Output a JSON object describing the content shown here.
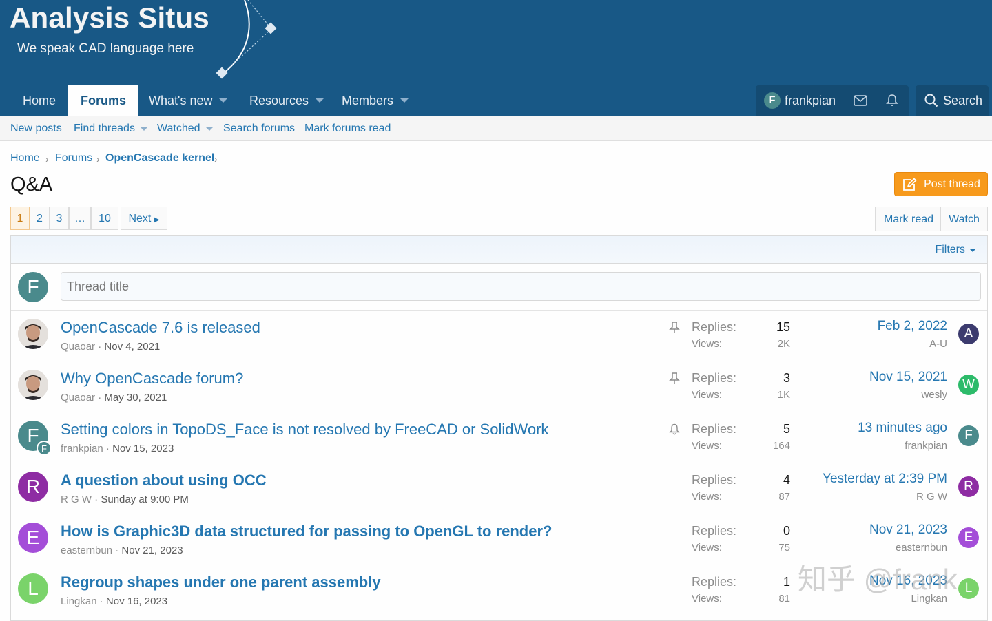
{
  "header": {
    "logo_title": "Analysis Situs",
    "logo_subtitle": "We speak CAD language here"
  },
  "nav": {
    "home": "Home",
    "forums": "Forums",
    "whats_new": "What's new",
    "resources": "Resources",
    "members": "Members",
    "username": "frankpian",
    "user_initial": "F",
    "search": "Search"
  },
  "subnav": {
    "new_posts": "New posts",
    "find_threads": "Find threads",
    "watched": "Watched",
    "search_forums": "Search forums",
    "mark_forums_read": "Mark forums read"
  },
  "breadcrumb": {
    "home": "Home",
    "forums": "Forums",
    "current": "OpenCascade kernel"
  },
  "page": {
    "title": "Q&A",
    "post_thread": "Post thread",
    "mark_read": "Mark read",
    "watch": "Watch",
    "filters": "Filters"
  },
  "pagination": {
    "pages": [
      "1",
      "2",
      "3",
      "…",
      "10"
    ],
    "current": "1",
    "next": "Next"
  },
  "new_thread": {
    "initial": "F",
    "placeholder": "Thread title"
  },
  "labels": {
    "replies": "Replies:",
    "views": "Views:"
  },
  "threads": [
    {
      "title": "OpenCascade 7.6 is released",
      "author": "Quaoar",
      "date": "Nov 4, 2021",
      "status_icon": "pin-icon",
      "replies": "15",
      "views": "2K",
      "last_date": "Feb 2, 2022",
      "last_user": "A-U",
      "last_initial": "A",
      "last_color": "#3c3b6e",
      "unread": false
    },
    {
      "title": "Why OpenCascade forum?",
      "author": "Quaoar",
      "date": "May 30, 2021",
      "status_icon": "pin-icon",
      "replies": "3",
      "views": "1K",
      "last_date": "Nov 15, 2021",
      "last_user": "wesly",
      "last_initial": "W",
      "last_color": "#2dbb6a",
      "unread": false
    },
    {
      "title": "Setting colors in TopoDS_Face is not resolved by FreeCAD or SolidWork",
      "author": "frankpian",
      "date": "Nov 15, 2023",
      "status_icon": "bell-icon",
      "replies": "5",
      "views": "164",
      "last_date": "13 minutes ago",
      "last_user": "frankpian",
      "last_initial": "F",
      "last_color": "#4a8a8c",
      "author_initial": "F",
      "author_badge": "F",
      "author_color": "#4a8a8c",
      "unread": false
    },
    {
      "title": "A question about using OCC",
      "author": "R G W",
      "date": "Sunday at 9:00 PM",
      "replies": "4",
      "views": "87",
      "last_date": "Yesterday at 2:39 PM",
      "last_user": "R G W",
      "last_initial": "R",
      "last_color": "#8e2ca3",
      "author_initial": "R",
      "author_color": "#8e2ca3",
      "unread": true
    },
    {
      "title": "How is Graphic3D data structured for passing to OpenGL to render?",
      "author": "easternbun",
      "date": "Nov 21, 2023",
      "replies": "0",
      "views": "75",
      "last_date": "Nov 21, 2023",
      "last_user": "easternbun",
      "last_initial": "E",
      "last_color": "#a44ed8",
      "author_initial": "E",
      "author_color": "#a44ed8",
      "unread": true
    },
    {
      "title": "Regroup shapes under one parent assembly",
      "author": "Lingkan",
      "date": "Nov 16, 2023",
      "replies": "1",
      "views": "81",
      "last_date": "Nov 16, 2023",
      "last_user": "Lingkan",
      "last_initial": "L",
      "last_color": "#7ad36a",
      "author_initial": "L",
      "author_color": "#7ad36a",
      "unread": true
    }
  ],
  "watermark": "知乎 @frank"
}
